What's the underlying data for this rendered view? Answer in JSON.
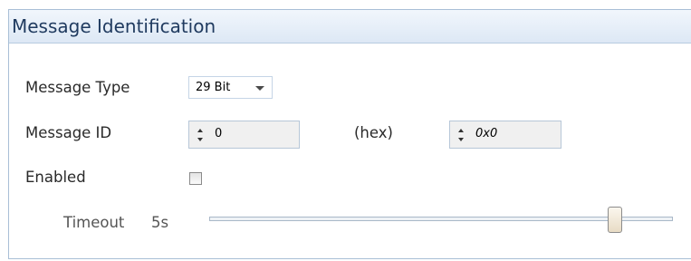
{
  "panel": {
    "title": "Message Identification"
  },
  "fields": {
    "message_type": {
      "label": "Message Type",
      "value": "29 Bit"
    },
    "message_id": {
      "label": "Message ID",
      "value": "0",
      "hex_label": "(hex)",
      "hex_value": "0x0"
    },
    "enabled": {
      "label": "Enabled",
      "checked": false
    },
    "timeout": {
      "label": "Timeout",
      "value": "5s",
      "slider_fraction": 0.88
    }
  },
  "colors": {
    "header_gradient_top": "#f1f6fc",
    "header_gradient_bottom": "#dde8f5",
    "title_text": "#1f3a5f",
    "border": "#a9bfd6"
  }
}
